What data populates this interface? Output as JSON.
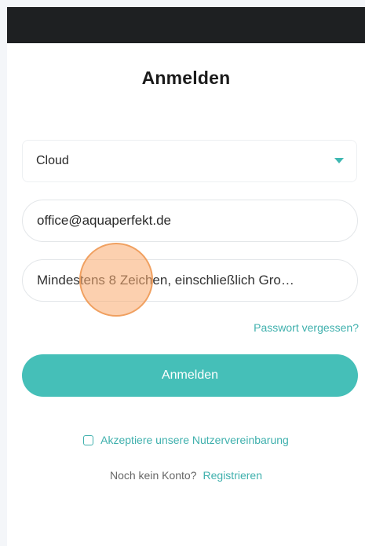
{
  "header": {
    "title": "Anmelden"
  },
  "form": {
    "server_select": {
      "value": "Cloud",
      "caret_icon": "chevron-down-icon"
    },
    "email": {
      "value": "office@aquaperfekt.de"
    },
    "password": {
      "placeholder": "Mindestens 8 Zeichen, einschließlich Gro…"
    },
    "forgot_password_label": "Passwort vergessen?",
    "login_button_label": "Anmelden",
    "agreement_label": "Akzeptiere unsere Nutzervereinbarung",
    "agreement_checked": false,
    "no_account_text": "Noch kein Konto?",
    "register_label": "Registrieren"
  },
  "colors": {
    "accent": "#45bfb8",
    "link": "#3fb0ad",
    "top_bar": "#1e2022",
    "tap_indicator": "#f0a060"
  }
}
